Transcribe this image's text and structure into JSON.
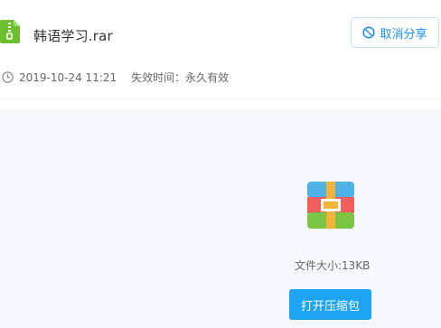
{
  "file": {
    "name": "韩语学习.rar",
    "icon": "zip-file-icon",
    "icon_color": "#6cc02e"
  },
  "actions": {
    "cancel_share_label": "取消分享",
    "cancel_share_icon": "ban-icon",
    "accent_color": "#1f8ef0"
  },
  "meta": {
    "clock_icon": "clock-icon",
    "date": "2019-10-24 11:21",
    "expiry_label": "失效时间：",
    "expiry_value": "永久有效"
  },
  "preview": {
    "icon": "archive-icon",
    "size_label": "文件大小:",
    "size_value": "13KB",
    "open_button_label": "打开压缩包",
    "button_color": "#1ea4f2"
  }
}
